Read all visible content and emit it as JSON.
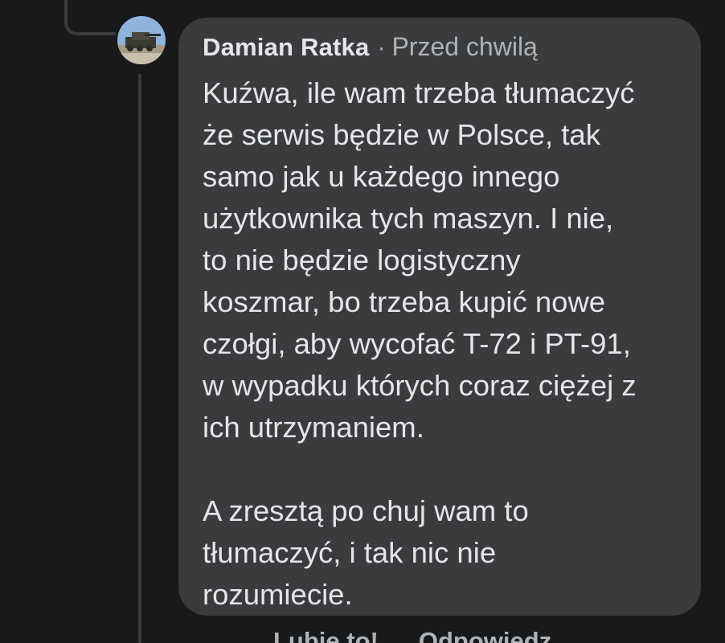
{
  "comment": {
    "author": "Damian Ratka",
    "separator": "·",
    "timestamp": "Przed chwilą",
    "paragraph1": [
      "Kuźwa, ile wam trzeba tłumaczyć",
      "że serwis będzie w Polsce, tak",
      "samo jak u każdego innego",
      "użytkownika tych maszyn. I nie,",
      "to nie będzie logistyczny",
      "koszmar, bo trzeba kupić nowe",
      "czołgi, aby wycofać T-72 i PT-91,",
      "w wypadku których coraz ciężej z",
      "ich utrzymaniem."
    ],
    "paragraph2": [
      "A zresztą po chuj wam to",
      "tłumaczyć, i tak nic nie",
      "rozumiecie."
    ]
  },
  "actions": {
    "like": "Lubię to!",
    "reply": "Odpowiedz"
  },
  "colors": {
    "background": "#18191a",
    "bubble": "#3a3b3c",
    "primary_text": "#e4e6eb",
    "secondary_text": "#b0b3b8"
  },
  "icons": {
    "avatar": "user-avatar-photo"
  }
}
